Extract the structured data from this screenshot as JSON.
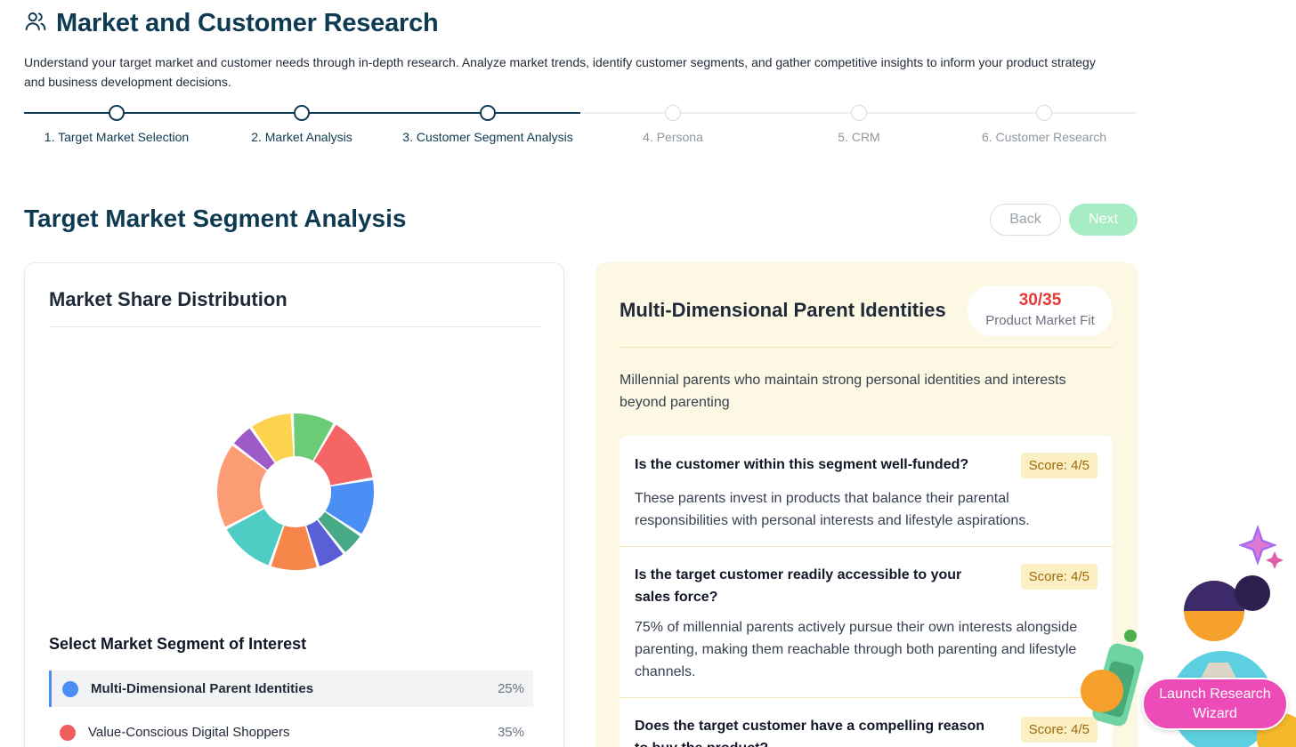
{
  "header": {
    "title": "Market and Customer Research",
    "description": "Understand your target market and customer needs through in-depth research. Analyze market trends, identify customer segments, and gather competitive insights to inform your product strategy and business development decisions."
  },
  "stepper": {
    "steps": [
      {
        "label": "1. Target Market Selection",
        "state": "active"
      },
      {
        "label": "2. Market Analysis",
        "state": "active"
      },
      {
        "label": "3. Customer Segment Analysis",
        "state": "active"
      },
      {
        "label": "4. Persona",
        "state": "inactive"
      },
      {
        "label": "5. CRM",
        "state": "inactive"
      },
      {
        "label": "6. Customer Research",
        "state": "inactive"
      }
    ]
  },
  "section": {
    "title": "Target Market Segment Analysis",
    "back_label": "Back",
    "next_label": "Next"
  },
  "market_share": {
    "title": "Market Share Distribution",
    "select_title": "Select Market Segment of Interest",
    "segments": [
      {
        "label": "Multi-Dimensional Parent Identities",
        "pct": "25%",
        "color": "#4b8ff5",
        "selected": true
      },
      {
        "label": "Value-Conscious Digital Shoppers",
        "pct": "35%",
        "color": "#f05d5e",
        "selected": false
      }
    ],
    "donut_colors": [
      "#f56565",
      "#4b8ff5",
      "#48a986",
      "#5a5fd6",
      "#f6864a",
      "#4ecdc4",
      "#fb9c74",
      "#9c5bc7",
      "#fcd34d",
      "#6bcb77"
    ]
  },
  "detail": {
    "segment_name": "Multi-Dimensional Parent Identities",
    "pmf_score": "30/35",
    "pmf_label": "Product Market Fit",
    "description": "Millennial parents who maintain strong personal identities and interests beyond parenting",
    "questions": [
      {
        "question": "Is the customer within this segment well-funded?",
        "score": "Score: 4/5",
        "answer": "These parents invest in products that balance their parental responsibilities with personal interests and lifestyle aspirations."
      },
      {
        "question": "Is the target customer readily accessible to your sales force?",
        "score": "Score: 4/5",
        "answer": "75% of millennial parents actively pursue their own interests alongside parenting, making them reachable through both parenting and lifestyle channels."
      },
      {
        "question": "Does the target customer have a compelling reason to buy the product?",
        "score": "Score: 4/5",
        "answer": ""
      }
    ]
  },
  "wizard": {
    "label_line1": "Launch Research",
    "label_line2": "Wizard"
  },
  "icons": {
    "header": "users-icon"
  }
}
